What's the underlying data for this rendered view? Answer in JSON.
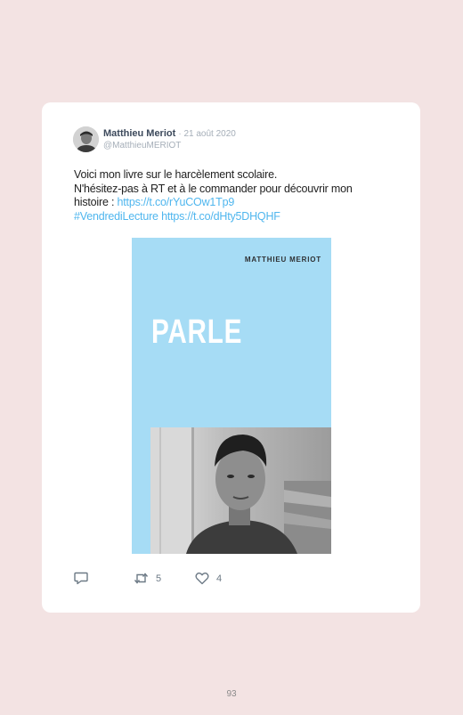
{
  "tweet": {
    "author_name": "Matthieu Meriot",
    "date": "· 21 août 2020",
    "handle": "@MatthieuMERIOT",
    "text_line1": "Voici mon livre sur le harcèlement scolaire.",
    "text_line2": "N'hésitez-pas à RT et à le commander pour découvrir mon",
    "text_line3_prefix": "histoire : ",
    "link1": "https://t.co/rYuCOw1Tp9",
    "hashtag": "#VendrediLecture",
    "link2": "https://t.co/dHty5DHQHF"
  },
  "book_cover": {
    "author": "MATTHIEU MERIOT",
    "title": "PARLE",
    "background_color": "#a6dcf5"
  },
  "actions": {
    "reply_icon": "speech-bubble-icon",
    "retweet_icon": "retweet-icon",
    "retweet_count": "5",
    "like_icon": "heart-icon",
    "like_count": "4"
  },
  "page": {
    "number": "93"
  },
  "colors": {
    "page_background": "#f3e3e3",
    "card_background": "#ffffff",
    "link": "#4fb6ee",
    "icon": "#6d7a86"
  }
}
